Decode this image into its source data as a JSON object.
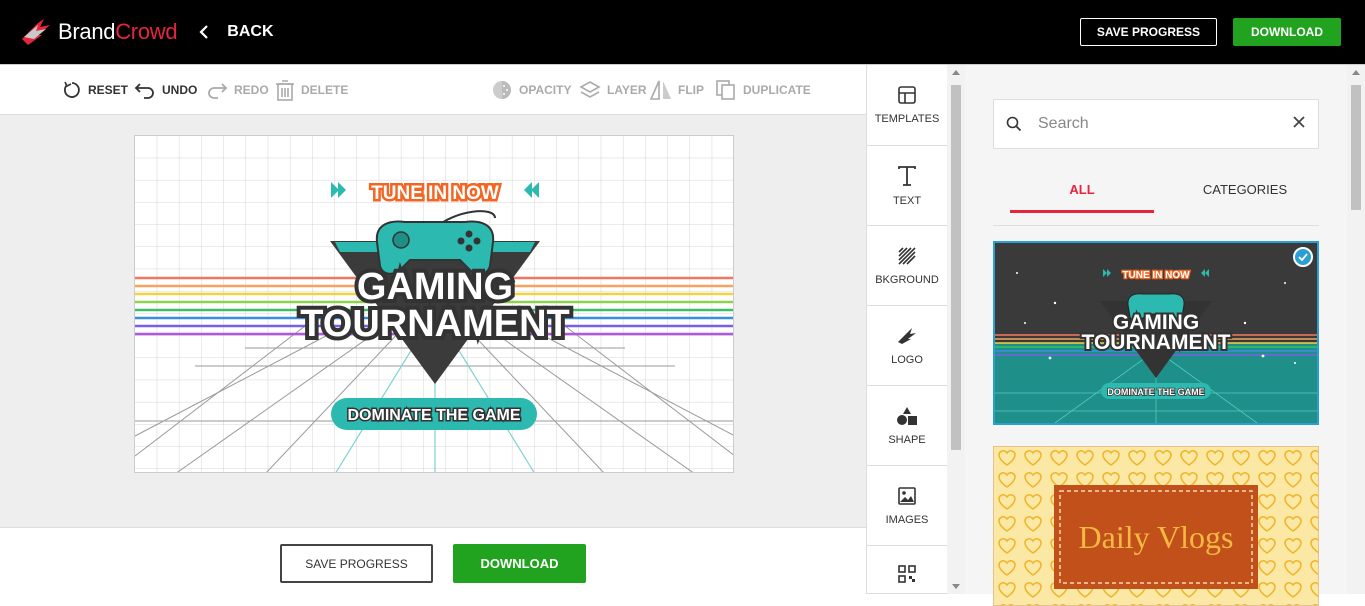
{
  "brand": {
    "name_part1": "Brand",
    "name_part2": "Crowd"
  },
  "header": {
    "back_label": "BACK",
    "save_label": "SAVE PROGRESS",
    "download_label": "DOWNLOAD"
  },
  "toolbar": {
    "reset": "RESET",
    "undo": "UNDO",
    "redo": "REDO",
    "delete": "DELETE",
    "opacity": "OPACITY",
    "layer": "LAYER",
    "flip": "FLIP",
    "duplicate": "DUPLICATE"
  },
  "design": {
    "tagline_top": "TUNE IN NOW",
    "title_line1": "GAMING",
    "title_line2": "TOURNAMENT",
    "cta": "DOMINATE THE GAME"
  },
  "bottom": {
    "save_label": "SAVE PROGRESS",
    "download_label": "DOWNLOAD"
  },
  "sidenav": {
    "templates": "TEMPLATES",
    "text": "TEXT",
    "background": "BKGROUND",
    "logo": "LOGO",
    "shape": "SHAPE",
    "images": "IMAGES"
  },
  "panel": {
    "search_placeholder": "Search",
    "tab_all": "ALL",
    "tab_categories": "CATEGORIES",
    "template1": {
      "top": "TUNE IN NOW",
      "line1": "GAMING",
      "line2": "TOURNAMENT",
      "cta": "DOMINATE THE GAME"
    },
    "template2": {
      "title": "Daily Vlogs"
    }
  },
  "colors": {
    "accent_red": "#e6253d",
    "download_green": "#21a31f",
    "selection_blue": "#2a9fd6",
    "teal": "#2bb9b0",
    "orange": "#f26522"
  }
}
